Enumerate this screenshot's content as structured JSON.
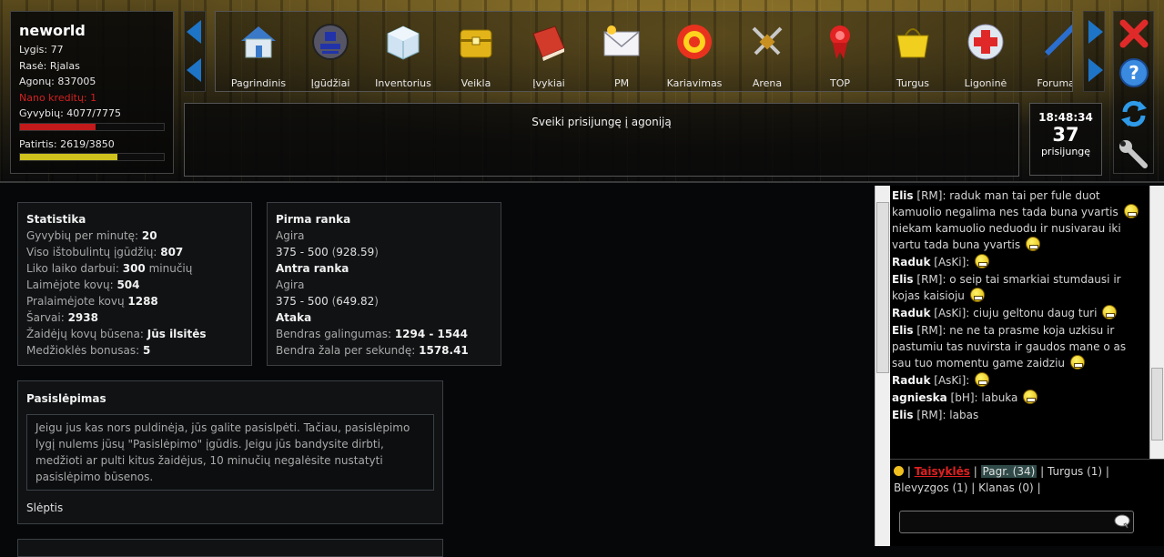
{
  "player": {
    "name": "neworld",
    "level": "Lygis: 77",
    "race": "Rasė: Rjalas",
    "money": "Agonų: 837005",
    "nano": "Nano kreditų: 1",
    "hp": "Gyvybių: 4077/7775",
    "hp_fraction": 0.524,
    "xp": "Patirtis: 2619/3850",
    "xp_fraction": 0.68
  },
  "nav": {
    "items": [
      {
        "label": "Pagrindinis",
        "icon": "home-icon"
      },
      {
        "label": "Įgūdžiai",
        "icon": "skills-icon"
      },
      {
        "label": "Inventorius",
        "icon": "box-icon"
      },
      {
        "label": "Veikla",
        "icon": "chest-icon"
      },
      {
        "label": "Įvykiai",
        "icon": "book-icon"
      },
      {
        "label": "PM",
        "icon": "mail-icon"
      },
      {
        "label": "Kariavimas",
        "icon": "target-icon"
      },
      {
        "label": "Arena",
        "icon": "swords-icon"
      },
      {
        "label": "TOP",
        "icon": "ribbon-icon"
      },
      {
        "label": "Turgus",
        "icon": "bag-icon"
      },
      {
        "label": "Ligoninė",
        "icon": "medical-icon"
      },
      {
        "label": "Forumas",
        "icon": "pen-icon"
      }
    ]
  },
  "welcome": "Sveiki prisijungę į agoniją",
  "clock": {
    "time": "18:48:34",
    "online": "37",
    "online_label": "prisijungę"
  },
  "stats": {
    "title": "Statistika",
    "rows": [
      {
        "label": "Gyvybių per minutę: ",
        "value": "20",
        "suffix": ""
      },
      {
        "label": "Viso ištobulintų įgūdžių: ",
        "value": "807",
        "suffix": ""
      },
      {
        "label": "Liko laiko darbui: ",
        "value": "300",
        "suffix": " minučių"
      },
      {
        "label": "Laimėjote kovų: ",
        "value": "504",
        "suffix": ""
      },
      {
        "label": "Pralaimėjote kovų ",
        "value": "1288",
        "suffix": ""
      },
      {
        "label": "Šarvai: ",
        "value": "2938",
        "suffix": ""
      },
      {
        "label": "Žaidėjų kovų būsena: ",
        "value": "Jūs ilsitės",
        "suffix": ""
      },
      {
        "label": "Medžioklės bonusas: ",
        "value": "5",
        "suffix": ""
      }
    ]
  },
  "weapons": {
    "first_title": "Pirma ranka",
    "first_name": "Agira",
    "first_dmg": "375 - 500",
    "first_avg": "928.59",
    "second_title": "Antra ranka",
    "second_name": "Agira",
    "second_dmg": "375 - 500",
    "second_avg": "649.82",
    "attack_title": "Ataka",
    "power_label": "Bendras galingumas: ",
    "power_value": "1294 - 1544",
    "dps_label": "Bendra žala per sekundę: ",
    "dps_value": "1578.41"
  },
  "hide": {
    "title": "Pasislėpimas",
    "text": "Jeigu jus kas nors puldinėja, jūs galite pasislpėti. Tačiau, pasislėpimo lygį nulems jūsų \"Pasislėpimo\" įgūdis. Jeigu jūs bandysite dirbti, medžioti ar pulti kitus žaidėjus, 10 minučių negalėsite nustatyti pasislėpimo būsenos.",
    "link": "Slėptis"
  },
  "chat": {
    "messages": [
      {
        "author": "Elis",
        "tag": " [RM]",
        "text": ": raduk man tai per fule duot kamuolio negalima nes tada buna yvartis",
        "smiley": true,
        "after": " niekam kamuolio neduodu ir nusivarau iki vartu tada buna yvartis",
        "smiley2": true
      },
      {
        "author": "Raduk",
        "tag": " [AsKi]",
        "text": ":",
        "smiley": true,
        "after": "",
        "smiley2": false
      },
      {
        "author": "Elis",
        "tag": " [RM]",
        "text": ": o seip tai smarkiai stumdausi ir kojas kaisioju",
        "smiley": true,
        "after": "",
        "smiley2": false
      },
      {
        "author": "Raduk",
        "tag": " [AsKi]",
        "text": ": ciuju geltonu daug turi",
        "smiley": true,
        "after": "",
        "smiley2": false
      },
      {
        "author": "Elis",
        "tag": " [RM]",
        "text": ": ne ne ta prasme koja uzkisu ir pastumiu tas nuvirsta ir gaudos mane o as sau tuo momentu game zaidziu",
        "smiley": true,
        "after": "",
        "smiley2": false
      },
      {
        "author": "Raduk",
        "tag": " [AsKi]",
        "text": ":",
        "smiley": true,
        "after": "",
        "smiley2": false
      },
      {
        "author": "agnieska",
        "tag": " [bH]",
        "text": ": labuka",
        "smiley": true,
        "after": "",
        "smiley2": false
      },
      {
        "author": "Elis",
        "tag": " [RM]",
        "text": ": labas",
        "smiley": false,
        "after": "",
        "smiley2": false
      }
    ],
    "tabs": {
      "rules": "Taisyklės",
      "main": "Pagr. (34)",
      "market": "Turgus (1)",
      "fleas": "Blevyzgos (1)",
      "clan": "Klanas (0)"
    },
    "input_value": ""
  },
  "colors": {
    "accent_blue": "#1e74c6",
    "hp_red": "#c21a1a",
    "xp_yellow": "#cfc21c",
    "nano_red": "#d32020"
  }
}
